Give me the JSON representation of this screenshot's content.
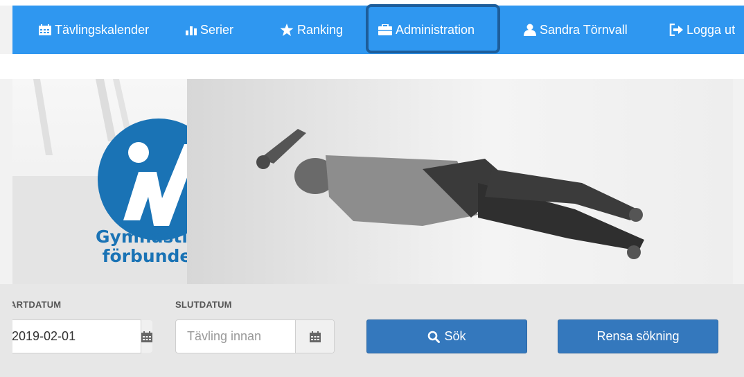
{
  "colors": {
    "nav_bg": "#2f97f0",
    "highlight_border": "#1d5d9a",
    "button_bg": "#3478bd",
    "logo_blue": "#1a73b5"
  },
  "nav": {
    "items": [
      {
        "label": "Tävlingskalender",
        "icon": "calendar-icon"
      },
      {
        "label": "Serier",
        "icon": "bar-chart-icon"
      },
      {
        "label": "Ranking",
        "icon": "star-icon"
      },
      {
        "label": "Administration",
        "icon": "briefcase-icon"
      },
      {
        "label": "Sandra Törnvall",
        "icon": "user-icon"
      },
      {
        "label": "Logga ut",
        "icon": "logout-icon"
      }
    ]
  },
  "hero": {
    "logo_line1": "Gymnastik-",
    "logo_line2": "förbundet"
  },
  "search": {
    "start_label": "STARTDATUM",
    "start_value": "2019-02-01",
    "end_label": "SLUTDATUM",
    "end_placeholder": "Tävling innan",
    "search_button": "Sök",
    "clear_button": "Rensa sökning"
  }
}
